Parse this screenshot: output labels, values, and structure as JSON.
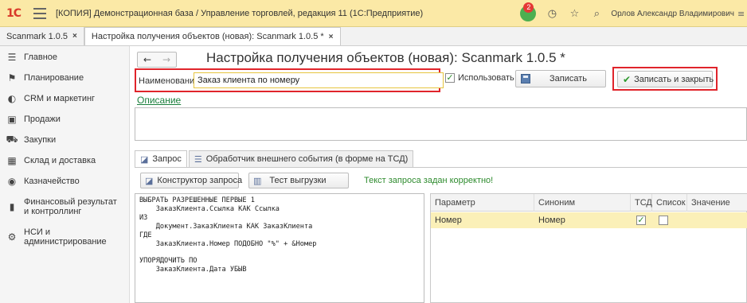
{
  "app": {
    "logo_text": "1С",
    "title": "[КОПИЯ] Демонстрационная база / Управление торговлей, редакция 11  (1С:Предприятие)",
    "notifications_count": "2",
    "user_name": "Орлов Александр Владимирович",
    "icons": [
      "menu-icon",
      "notification-icon",
      "history-icon",
      "star-icon",
      "search-icon",
      "more-icon"
    ]
  },
  "tabs": [
    {
      "label": "Scanmark 1.0.5",
      "close": "×"
    },
    {
      "label": "Настройка получения объектов (новая): Scanmark 1.0.5 *",
      "close": "×"
    }
  ],
  "sidebar": {
    "items": [
      {
        "label": "Главное",
        "icon": "menu-lines-icon"
      },
      {
        "label": "Планирование",
        "icon": "planning-icon"
      },
      {
        "label": "CRM и маркетинг",
        "icon": "crm-icon"
      },
      {
        "label": "Продажи",
        "icon": "sales-icon"
      },
      {
        "label": "Закупки",
        "icon": "cart-icon"
      },
      {
        "label": "Склад и доставка",
        "icon": "warehouse-icon"
      },
      {
        "label": "Казначейство",
        "icon": "treasury-icon"
      },
      {
        "label": "Финансовый результат и контроллинг",
        "icon": "chart-icon"
      },
      {
        "label": "НСИ и администрирование",
        "icon": "gear-icon"
      }
    ]
  },
  "form": {
    "title": "Настройка получения объектов (новая): Scanmark 1.0.5 *",
    "name_label": "Наименование:",
    "name_value": "Заказ клиента по номеру",
    "use_label": "Использовать",
    "use_checked": true,
    "save_label": "Записать",
    "save_close_label": "Записать и закрыть",
    "description_link": "Описание",
    "description_value": ""
  },
  "form_tabs": [
    {
      "label": "Запрос",
      "icon": "query-icon",
      "active": true
    },
    {
      "label": "Обработчик внешнего события (в форме на ТСД)",
      "icon": "handler-icon",
      "active": false
    }
  ],
  "query_toolbar": {
    "constructor_label": "Конструктор запроса",
    "test_label": "Тест выгрузки",
    "status": "Текст запроса задан корректно!"
  },
  "query_text": "ВЫБРАТЬ РАЗРЕШЕННЫЕ ПЕРВЫЕ 1\n    ЗаказКлиента.Ссылка КАК Ссылка\nИЗ\n    Документ.ЗаказКлиента КАК ЗаказКлиента\nГДЕ\n    ЗаказКлиента.Номер ПОДОБНО \"%\" + &Номер\n\nУПОРЯДОЧИТЬ ПО\n    ЗаказКлиента.Дата УБЫВ",
  "params_table": {
    "columns": [
      "Параметр",
      "Синоним",
      "ТСД",
      "Список",
      "Значение"
    ],
    "rows": [
      {
        "param": "Номер",
        "synonym": "Номер",
        "tsd": true,
        "list": false,
        "value": ""
      }
    ]
  },
  "colors": {
    "titlebar_bg": "#fbe9a6",
    "highlight_red": "#e0242b",
    "link_green": "#1a7f3c",
    "ok_green": "#2e8b2e",
    "selected_row": "#fbf0b8"
  }
}
